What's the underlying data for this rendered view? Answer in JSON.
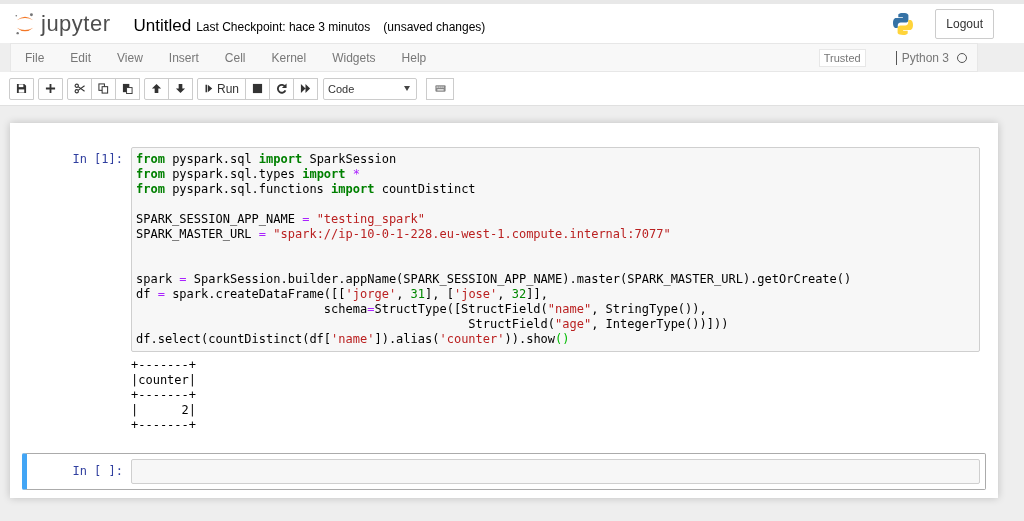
{
  "header": {
    "logo_text": "jupyter",
    "notebook_name": "Untitled",
    "checkpoint": "Last Checkpoint: hace 3 minutos",
    "save_status": "(unsaved changes)",
    "logout": "Logout"
  },
  "menu": {
    "items": [
      "File",
      "Edit",
      "View",
      "Insert",
      "Cell",
      "Kernel",
      "Widgets",
      "Help"
    ],
    "trusted": "Trusted",
    "kernel": "Python 3",
    "kernel_busy": false
  },
  "toolbar": {
    "groups": [
      {
        "buttons": [
          {
            "kind": "save"
          }
        ]
      },
      {
        "buttons": [
          {
            "kind": "plus"
          }
        ]
      },
      {
        "buttons": [
          {
            "kind": "cut"
          },
          {
            "kind": "copy"
          },
          {
            "kind": "paste"
          }
        ]
      },
      {
        "buttons": [
          {
            "kind": "up"
          },
          {
            "kind": "down"
          }
        ]
      },
      {
        "buttons": [
          {
            "kind": "run",
            "label": "Run"
          },
          {
            "kind": "stop"
          },
          {
            "kind": "restart"
          },
          {
            "kind": "fast-forward"
          }
        ]
      }
    ],
    "cell_type": "Code"
  },
  "cells": [
    {
      "prompt": "In [1]:",
      "selected": false,
      "lines": [
        {
          "kind": "code",
          "tokens": [
            {
              "text": "from",
              "kind": "keyword"
            },
            {
              "text": " pyspark.sql ",
              "kind": "plain"
            },
            {
              "text": "import",
              "kind": "keyword"
            },
            {
              "text": " SparkSession",
              "kind": "plain"
            }
          ]
        },
        {
          "kind": "code",
          "tokens": [
            {
              "text": "from",
              "kind": "keyword"
            },
            {
              "text": " pyspark.sql.types ",
              "kind": "plain"
            },
            {
              "text": "import",
              "kind": "keyword"
            },
            {
              "text": " *",
              "kind": "operator"
            }
          ]
        },
        {
          "kind": "code",
          "tokens": [
            {
              "text": "from",
              "kind": "keyword"
            },
            {
              "text": " pyspark.sql.functions ",
              "kind": "plain"
            },
            {
              "text": "import",
              "kind": "keyword"
            },
            {
              "text": " countDistinct",
              "kind": "plain"
            }
          ]
        },
        {
          "kind": "blank"
        },
        {
          "kind": "code",
          "tokens": [
            {
              "text": "SPARK_SESSION_APP_NAME ",
              "kind": "plain"
            },
            {
              "text": "=",
              "kind": "operator"
            },
            {
              "text": " \"testing_spark\"",
              "kind": "string"
            }
          ]
        },
        {
          "kind": "code",
          "tokens": [
            {
              "text": "SPARK_MASTER_URL ",
              "kind": "plain"
            },
            {
              "text": "=",
              "kind": "operator"
            },
            {
              "text": " \"spark://ip-10-0-1-228.eu-west-1.compute.internal:7077\"",
              "kind": "string"
            }
          ]
        },
        {
          "kind": "blank"
        },
        {
          "kind": "blank"
        },
        {
          "kind": "code",
          "tokens": [
            {
              "text": "spark ",
              "kind": "plain"
            },
            {
              "text": "=",
              "kind": "operator"
            },
            {
              "text": " SparkSession.builder.appName(SPARK_SESSION_APP_NAME).master(SPARK_MASTER_URL).getOrCreate()",
              "kind": "plain"
            }
          ]
        },
        {
          "kind": "code",
          "tokens": [
            {
              "text": "df ",
              "kind": "plain"
            },
            {
              "text": "=",
              "kind": "operator"
            },
            {
              "text": " spark.createDataFrame([[",
              "kind": "plain"
            },
            {
              "text": "'jorge'",
              "kind": "string"
            },
            {
              "text": ", ",
              "kind": "plain"
            },
            {
              "text": "31",
              "kind": "number"
            },
            {
              "text": "], [",
              "kind": "plain"
            },
            {
              "text": "'jose'",
              "kind": "string"
            },
            {
              "text": ", ",
              "kind": "plain"
            },
            {
              "text": "32",
              "kind": "number"
            },
            {
              "text": "]],",
              "kind": "plain"
            }
          ]
        },
        {
          "kind": "code",
          "tokens": [
            {
              "text": "                          schema",
              "kind": "plain"
            },
            {
              "text": "=",
              "kind": "operator"
            },
            {
              "text": "StructType([StructField(",
              "kind": "plain"
            },
            {
              "text": "\"name\"",
              "kind": "string"
            },
            {
              "text": ", StringType()),",
              "kind": "plain"
            }
          ]
        },
        {
          "kind": "code",
          "tokens": [
            {
              "text": "                                              StructField(",
              "kind": "plain"
            },
            {
              "text": "\"age\"",
              "kind": "string"
            },
            {
              "text": ", IntegerType())]))",
              "kind": "plain"
            }
          ]
        },
        {
          "kind": "code",
          "tokens": [
            {
              "text": "df.select(countDistinct(df[",
              "kind": "plain"
            },
            {
              "text": "'name'",
              "kind": "string"
            },
            {
              "text": "]).alias(",
              "kind": "plain"
            },
            {
              "text": "'counter'",
              "kind": "string"
            },
            {
              "text": ")).show",
              "kind": "plain"
            },
            {
              "text": "()",
              "kind": "bracket-match"
            }
          ]
        }
      ],
      "output": [
        "+-------+",
        "|counter|",
        "+-------+",
        "|      2|",
        "+-------+"
      ]
    },
    {
      "prompt": "In [ ]:",
      "selected": true
    }
  ]
}
